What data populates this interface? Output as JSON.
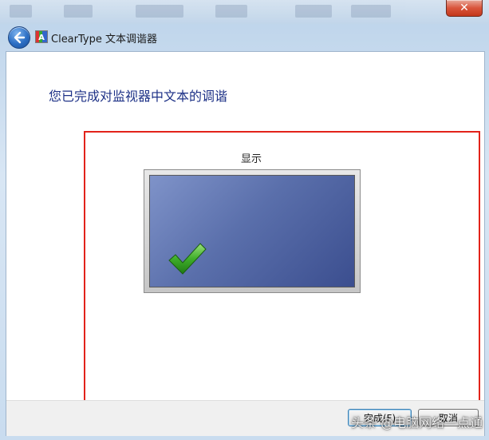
{
  "window": {
    "title": "ClearType 文本调谐器",
    "close_glyph": "✕"
  },
  "nav": {
    "back_icon": "back-arrow-icon",
    "app_icon": "cleartype-icon"
  },
  "content": {
    "heading": "您已完成对监视器中文本的调谐",
    "display_label": "显示",
    "monitor_icon": "check-mark-icon"
  },
  "footer": {
    "finish_label": "完成(F)",
    "cancel_label": "取消"
  },
  "watermark": {
    "text": "头条 @电脑网络一点通"
  },
  "colors": {
    "heading": "#1e3287",
    "highlight_box": "#e2231a",
    "screen": "#5a6fab",
    "check": "#3fae2a"
  }
}
